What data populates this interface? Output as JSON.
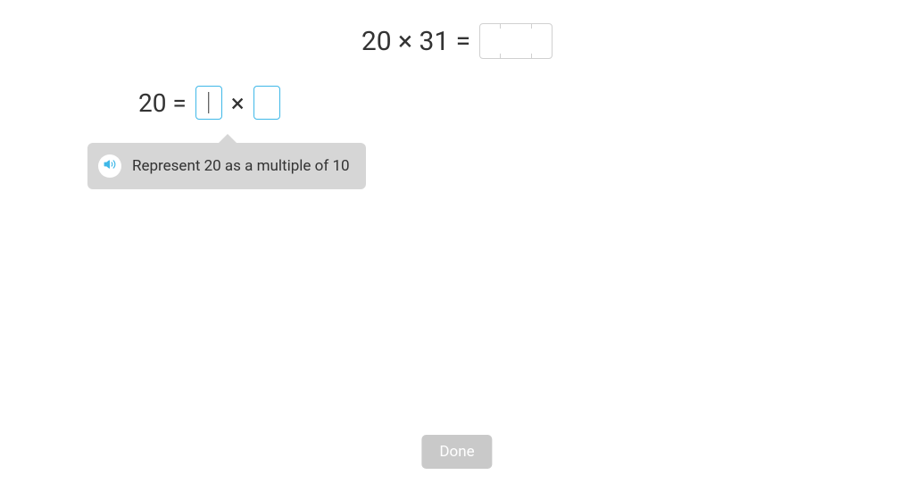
{
  "main_equation": {
    "lhs": "20 × 31 ="
  },
  "sub_equation": {
    "lhs": "20 =",
    "operator": "×"
  },
  "tooltip": {
    "text": "Represent 20 as a multiple of 10"
  },
  "buttons": {
    "done": "Done"
  },
  "colors": {
    "accent": "#3fb8e8",
    "tooltip_bg": "#d6d6d6",
    "done_bg": "#c9c9c9"
  }
}
